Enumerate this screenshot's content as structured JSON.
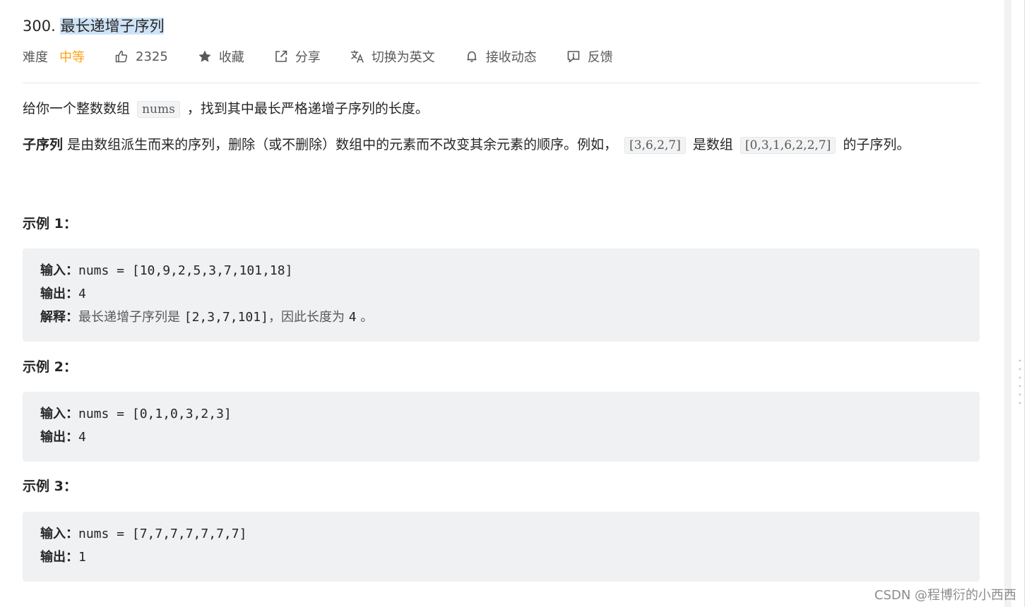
{
  "problem": {
    "number": "300.",
    "title": "最长递增子序列"
  },
  "meta": {
    "difficulty_label": "难度",
    "difficulty_value": "中等",
    "likes": "2325",
    "favorite_label": "收藏",
    "share_label": "分享",
    "switch_lang_label": "切换为英文",
    "subscribe_label": "接收动态",
    "feedback_label": "反馈",
    "difficulty_color": "#ffa116"
  },
  "description": {
    "p1_before": "给你一个整数数组",
    "p1_code": "nums",
    "p1_after": "，找到其中最长严格递增子序列的长度。",
    "p2_strong": "子序列",
    "p2_text1": "是由数组派生而来的序列，删除（或不删除）数组中的元素而不改变其余元素的顺序。例如，",
    "p2_code1": "[3,6,2,7]",
    "p2_text2": "是数组",
    "p2_code2": "[0,3,1,6,2,2,7]",
    "p2_text3": "的子序列。"
  },
  "examples": [
    {
      "title": "示例 1：",
      "input_key": "输入：",
      "input_val": "nums = [10,9,2,5,3,7,101,18]",
      "output_key": "输出：",
      "output_val": "4",
      "explain_key": "解释：",
      "explain_cn1": "最长递增子序列是 ",
      "explain_code1": "[2,3,7,101]",
      "explain_cn2": "，因此长度为 ",
      "explain_code2": "4",
      "explain_cn3": " 。"
    },
    {
      "title": "示例 2：",
      "input_key": "输入：",
      "input_val": "nums = [0,1,0,3,2,3]",
      "output_key": "输出：",
      "output_val": "4"
    },
    {
      "title": "示例 3：",
      "input_key": "输入：",
      "input_val": "nums = [7,7,7,7,7,7,7]",
      "output_key": "输出：",
      "output_val": "1"
    }
  ],
  "watermark": "CSDN @程博衍的小西西",
  "icons": [
    "thumb-up-icon",
    "star-icon",
    "share-icon",
    "translate-icon",
    "bell-icon",
    "feedback-icon"
  ]
}
